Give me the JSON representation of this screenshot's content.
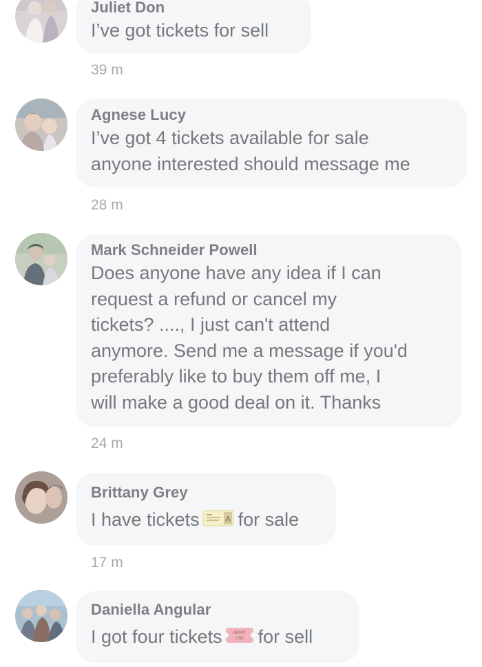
{
  "comments": [
    {
      "name": "Juliet Don",
      "text": "I’ve got tickets for sell",
      "time": "39 m",
      "avatar_icon": "juliet-don-avatar"
    },
    {
      "name": "Agnese Lucy",
      "text_lines": [
        "I’ve got 4 tickets available for sale",
        "anyone interested should message me"
      ],
      "time": "28 m",
      "avatar_icon": "agnese-lucy-avatar"
    },
    {
      "name": "Mark Schneider Powell",
      "text_lines": [
        "Does anyone have any idea if I can",
        "request a refund or cancel my",
        "tickets? ...., I just can't attend",
        "anymore. Send me a message if you'd",
        "preferably like to buy them off me, I",
        "will make a good deal on it. Thanks"
      ],
      "time": "24 m",
      "avatar_icon": "mark-schneider-powell-avatar"
    },
    {
      "name": "Brittany Grey",
      "text_before": "I have tickets",
      "text_after": "for sale",
      "emoji": "ticket-emoji",
      "time": "17 m",
      "avatar_icon": "brittany-grey-avatar"
    },
    {
      "name": "Daniella Angular",
      "text_before": "I got four tickets",
      "text_after": "for sell",
      "emoji": "admission-tickets-emoji",
      "time": "",
      "avatar_icon": "daniella-angular-avatar"
    }
  ],
  "colors": {
    "bubble": "#f4f6f8",
    "name": "#7d7f82",
    "text": "#76787b",
    "time": "#a6a8ab"
  }
}
